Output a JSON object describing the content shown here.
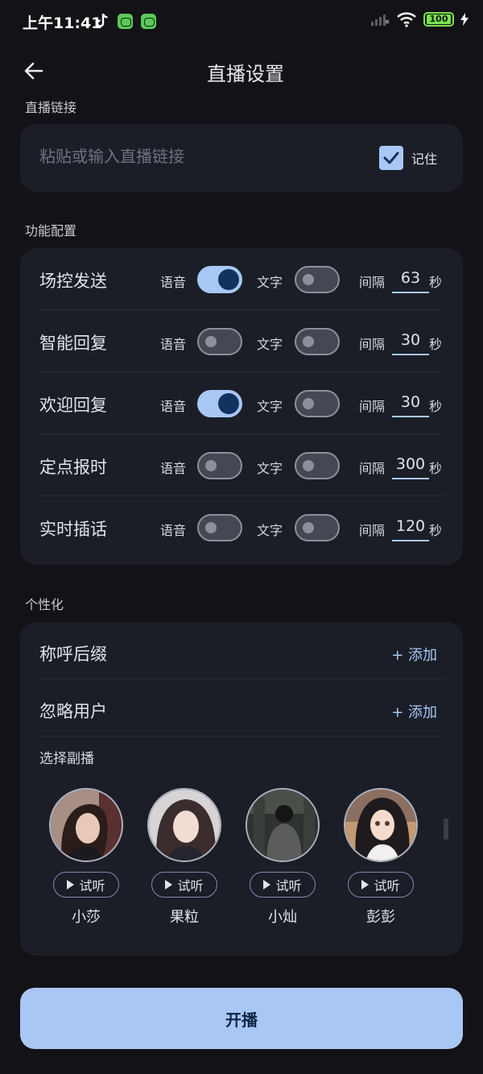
{
  "status_bar": {
    "time": "上午11:41",
    "battery": "100"
  },
  "header": {
    "title": "直播设置"
  },
  "live_link": {
    "section_label": "直播链接",
    "placeholder": "粘贴或输入直播链接",
    "value": "",
    "remember_label": "记住",
    "remember_checked": true
  },
  "functions": {
    "section_label": "功能配置",
    "voice_label": "语音",
    "text_label": "文字",
    "interval_label": "间隔",
    "seconds_label": "秒",
    "rows": [
      {
        "title": "场控发送",
        "voice_on": true,
        "text_on": false,
        "interval": "63"
      },
      {
        "title": "智能回复",
        "voice_on": false,
        "text_on": false,
        "interval": "30"
      },
      {
        "title": "欢迎回复",
        "voice_on": true,
        "text_on": false,
        "interval": "30"
      },
      {
        "title": "定点报时",
        "voice_on": false,
        "text_on": false,
        "interval": "300"
      },
      {
        "title": "实时插话",
        "voice_on": false,
        "text_on": false,
        "interval": "120"
      }
    ]
  },
  "personalization": {
    "section_label": "个性化",
    "rows": [
      {
        "title": "称呼后缀",
        "action": "+ 添加"
      },
      {
        "title": "忽略用户",
        "action": "+ 添加"
      }
    ],
    "co_host_label": "选择副播",
    "preview_label": "试听",
    "co_hosts": [
      {
        "name": "小莎"
      },
      {
        "name": "果粒"
      },
      {
        "name": "小灿"
      },
      {
        "name": "彭彭"
      }
    ]
  },
  "start_button": {
    "label": "开播"
  },
  "colors": {
    "background": "#131317",
    "card": "#1b1e27",
    "accent": "#a9c7f4",
    "accent_dark": "#12325f"
  }
}
